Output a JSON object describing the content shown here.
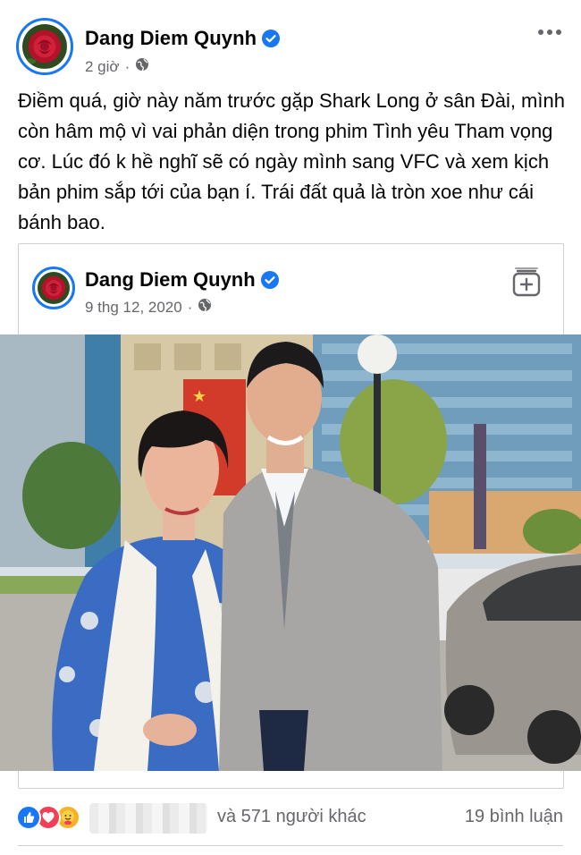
{
  "post": {
    "author": "Dang Diem Quynh",
    "time": "2 giờ",
    "text": "Điềm quá, giờ này năm trước gặp Shark Long ở sân Đài, mình còn hâm mộ vì vai phản diện trong phim Tình yêu Tham vọng cơ. Lúc đó k hề nghĩ sẽ có ngày mình sang VFC và xem kịch bản phim sắp tới của bạn í. Trái đất quả là tròn xoe như cái bánh bao."
  },
  "shared": {
    "author": "Dang Diem Quynh",
    "date": "9 thg 12, 2020"
  },
  "reactions": {
    "others_text": "và 571 người khác",
    "comments_text": "19 bình luận",
    "types": [
      "like-icon",
      "love-icon",
      "care-icon"
    ]
  },
  "colors": {
    "accent": "#1877f2",
    "secondary_text": "#65676b",
    "love": "#f33e58",
    "care": "#f7b125"
  }
}
